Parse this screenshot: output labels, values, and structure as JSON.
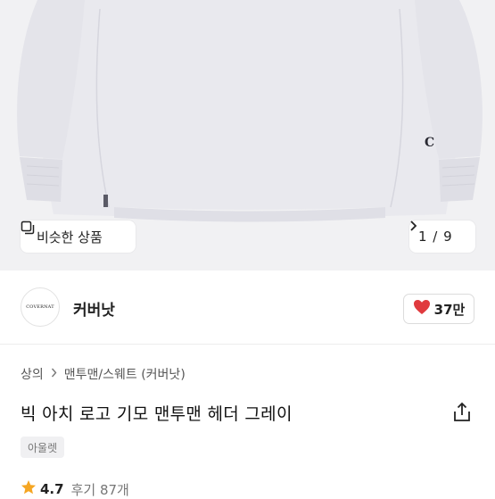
{
  "product_image": {
    "similar_label": "비슷한 상품",
    "pager": "1 / 9",
    "logo_letter": "C"
  },
  "store": {
    "logo_text": "COVERNAT",
    "name": "커버낫",
    "likes": "37만"
  },
  "breadcrumb": [
    "상의",
    "맨투맨/스웨트 (커버낫)"
  ],
  "product": {
    "title": "빅 아치 로고 기모 맨투맨 헤더 그레이",
    "tag": "아울렛",
    "rating": "4.7",
    "reviews": "후기 87개"
  },
  "colors": {
    "like_heart": "#e03a3e",
    "star": "#f5a623",
    "hero_bg": "#f1f1f3"
  }
}
